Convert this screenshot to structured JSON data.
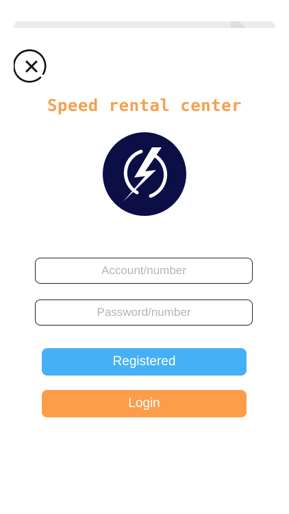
{
  "app": {
    "title": "Speed rental center"
  },
  "icons": {
    "close": "close-icon",
    "logo": "lightning-bolt-icon"
  },
  "form": {
    "account_placeholder": "Account/number",
    "password_placeholder": "Password/number",
    "account_value": "",
    "password_value": ""
  },
  "actions": {
    "register_label": "Registered",
    "login_label": "Login"
  },
  "colors": {
    "title": "#f5a04f",
    "logo_background": "#0c0f45",
    "register_button": "#45b0f6",
    "login_button": "#fd9d4a"
  }
}
